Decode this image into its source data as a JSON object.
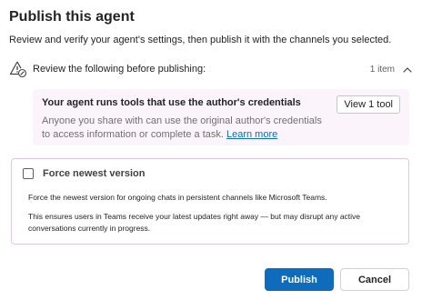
{
  "dialog": {
    "title": "Publish this agent",
    "subtitle": "Review and verify your agent's settings, then publish it with the channels you selected."
  },
  "review": {
    "label": "Review the following before publishing:",
    "count": "1 item",
    "icon": "warning-icon",
    "collapse_icon": "chevron-up-icon"
  },
  "notice": {
    "title": "Your agent runs tools that use the author's credentials",
    "body": "Anyone you share with can use the original author's credentials to access information or complete a task. ",
    "link": "Learn more",
    "button": "View 1 tool"
  },
  "force": {
    "label": "Force newest version",
    "checked": false,
    "desc1": "Force the newest version for ongoing chats in persistent channels like Microsoft Teams.",
    "desc2": "This ensures users in Teams receive your latest updates right away — but may disrupt any active conversations currently in progress."
  },
  "actions": {
    "publish": "Publish",
    "cancel": "Cancel"
  },
  "colors": {
    "accent": "#0f6cbd",
    "notice_bg": "#fbf5fb",
    "card_border": "#e0c9e0"
  }
}
